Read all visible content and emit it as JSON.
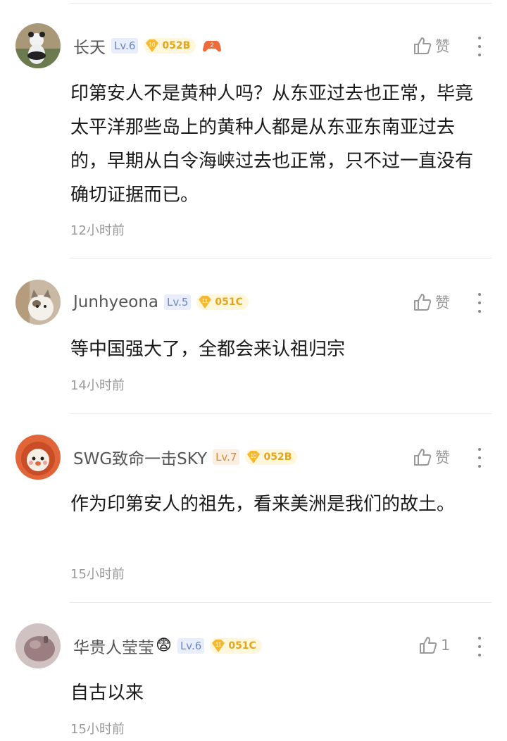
{
  "comments": [
    {
      "username": "长天",
      "level": "Lv.6",
      "badge_num": "10",
      "badge_code": "052B",
      "extra_icon": "gamepad-icon",
      "content": "印第安人不是黄种人吗？从东亚过去也正常，毕竟太平洋那些岛上的黄种人都是从东亚东南亚过去的，早期从白令海峡过去也正常，只不过一直没有确切证据而已。",
      "time": "12小时前",
      "like_label": "赞",
      "avatar_icon": "panda-avatar",
      "colors": {
        "avatar": "#8a7d62"
      }
    },
    {
      "username": "Junhyeona",
      "level": "Lv.5",
      "badge_num": "11",
      "badge_code": "051C",
      "content": "等中国强大了，全都会来认祖归宗",
      "time": "14小时前",
      "like_label": "赞",
      "avatar_icon": "cat-avatar",
      "colors": {
        "avatar": "#b8a896"
      }
    },
    {
      "username": "SWG致命一击SKY",
      "level": "Lv.7",
      "badge_num": "10",
      "badge_code": "052B",
      "content": "作为印第安人的祖先，看来美洲是我们的故土。",
      "time": "15小时前",
      "like_label": "赞",
      "avatar_icon": "lion-avatar",
      "colors": {
        "avatar": "#e0653a"
      }
    },
    {
      "username": "华贵人莹莹",
      "emoji": "😨",
      "level": "Lv.6",
      "badge_num": "11",
      "badge_code": "051C",
      "content": "自古以来",
      "time": "15小时前",
      "like_label": "1",
      "avatar_icon": "hand-avatar",
      "colors": {
        "avatar": "#9a7e80"
      }
    }
  ]
}
